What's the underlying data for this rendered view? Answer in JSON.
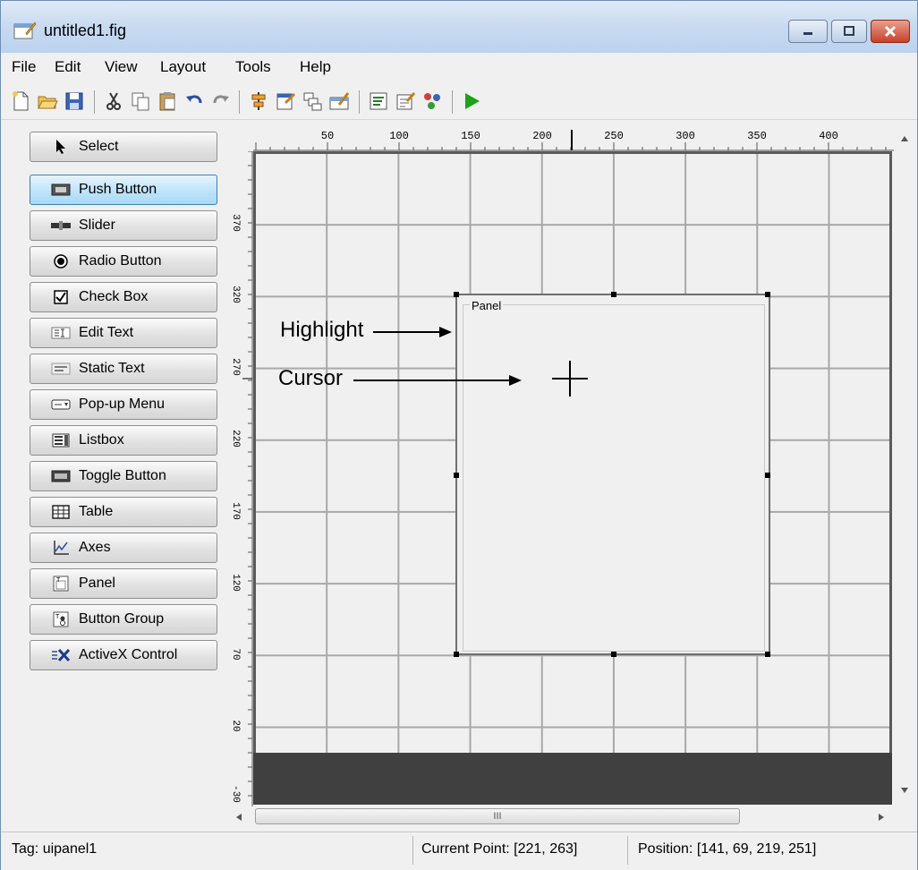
{
  "window": {
    "title": "untitled1.fig"
  },
  "menu": [
    "File",
    "Edit",
    "View",
    "Layout",
    "Tools",
    "Help"
  ],
  "toolbar": [
    "new-icon",
    "open-icon",
    "save-icon",
    "cut-icon",
    "copy-icon",
    "paste-icon",
    "undo-icon",
    "redo-icon",
    "align-icon",
    "menu-editor-icon",
    "tab-order-icon",
    "toolbar-editor-icon",
    "editor-icon",
    "property-inspector-icon",
    "object-browser-icon",
    "run-icon"
  ],
  "palette": {
    "items": [
      {
        "label": "Select",
        "icon": "arrow-cursor-icon"
      },
      {
        "label": "Push Button",
        "icon": "push-button-icon"
      },
      {
        "label": "Slider",
        "icon": "slider-icon"
      },
      {
        "label": "Radio Button",
        "icon": "radio-button-icon"
      },
      {
        "label": "Check Box",
        "icon": "check-box-icon"
      },
      {
        "label": "Edit Text",
        "icon": "edit-text-icon"
      },
      {
        "label": "Static Text",
        "icon": "static-text-icon"
      },
      {
        "label": "Pop-up Menu",
        "icon": "popup-menu-icon"
      },
      {
        "label": "Listbox",
        "icon": "listbox-icon"
      },
      {
        "label": "Toggle Button",
        "icon": "toggle-button-icon"
      },
      {
        "label": "Table",
        "icon": "table-icon"
      },
      {
        "label": "Axes",
        "icon": "axes-icon"
      },
      {
        "label": "Panel",
        "icon": "panel-icon"
      },
      {
        "label": "Button Group",
        "icon": "button-group-icon"
      },
      {
        "label": "ActiveX Control",
        "icon": "activex-icon"
      }
    ],
    "active_label": "Push Button"
  },
  "ruler": {
    "horizontal": [
      "50",
      "100",
      "150",
      "200",
      "250",
      "300",
      "350",
      "400"
    ],
    "vertical": [
      "370",
      "320",
      "270",
      "220",
      "170",
      "120",
      "70",
      "20",
      "-30"
    ]
  },
  "panel": {
    "title": "Panel"
  },
  "annotations": {
    "highlight": "Highlight",
    "cursor": "Cursor"
  },
  "status": {
    "tag": "Tag: uipanel1",
    "current_point": "Current Point:  [221, 263]",
    "position": "Position: [141, 69, 219, 251]"
  },
  "scrollbar": {
    "thumb_grip": "III"
  },
  "colors": {
    "titlebar": "#c8daf0",
    "active_button": "#bfe3fa",
    "close_button": "#c8412b",
    "grid_line": "#a8a8a8",
    "dark_band": "#404040",
    "run": "#1aa31a"
  }
}
